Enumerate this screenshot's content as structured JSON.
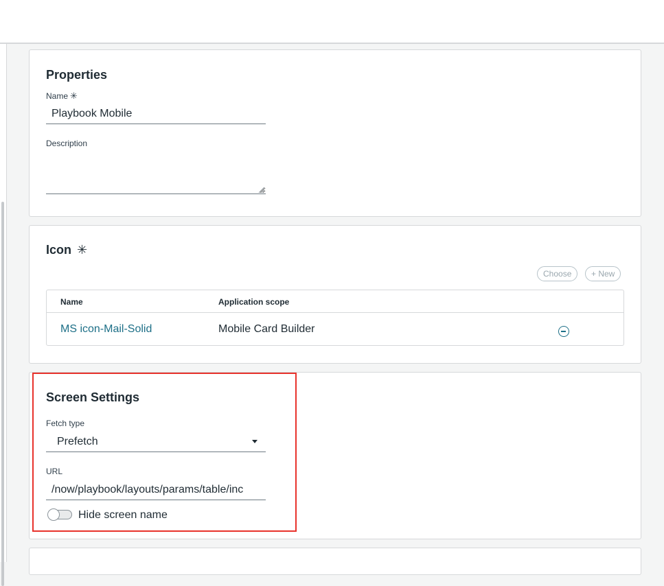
{
  "properties": {
    "title": "Properties",
    "name_label": "Name",
    "required_mark": "✳",
    "name_value": "Playbook Mobile",
    "description_label": "Description",
    "description_value": ""
  },
  "icon_section": {
    "title": "Icon",
    "required_mark": "✳",
    "choose_label": "Choose",
    "new_label": "+ New",
    "columns": [
      "Name",
      "Application scope"
    ],
    "rows": [
      {
        "name": "MS icon-Mail-Solid",
        "scope": "Mobile Card Builder"
      }
    ]
  },
  "screen_settings": {
    "title": "Screen Settings",
    "fetch_type_label": "Fetch type",
    "fetch_type_value": "Prefetch",
    "url_label": "URL",
    "url_value": "/now/playbook/layouts/params/table/inc",
    "hide_screen_name_label": "Hide screen name",
    "hide_screen_name_on": false
  },
  "colors": {
    "link": "#1d6f87",
    "highlight": "#e8322b"
  }
}
